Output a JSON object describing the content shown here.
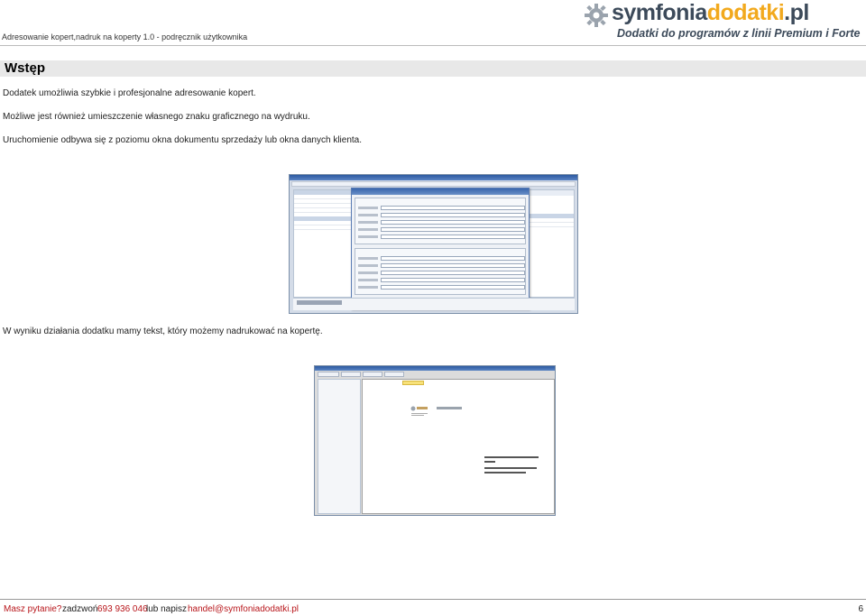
{
  "header": {
    "doc_title": "Adresowanie kopert,nadruk na koperty 1.0  - podręcznik użytkownika",
    "logo_brand": "symfonia",
    "logo_accent": "dodatki",
    "logo_tld": ".pl",
    "logo_tagline": "Dodatki do programów z linii Premium i Forte"
  },
  "section": {
    "title": "Wstęp"
  },
  "paragraphs": [
    "Dodatek umożliwia szybkie i profesjonalne adresowanie kopert.",
    "Możliwe jest również umieszczenie własnego znaku graficznego na wydruku.",
    "Uruchomienie odbywa się z poziomu okna dokumentu sprzedaży lub okna danych klienta.",
    "W wyniku działania dodatku mamy tekst, który możemy nadrukować na kopertę."
  ],
  "screenshot1": {
    "dialog_title": "Wybór adresu",
    "totals_label": "Do zapłaty:",
    "totals_value": "553,50",
    "totals_currency": "zł"
  },
  "footer": {
    "question": "Masz pytanie?",
    "call": "zadzwoń",
    "phone": "693 936 046",
    "or_write": "lub napisz",
    "email": "handel@symfoniadodatki.pl",
    "page_number": "6"
  },
  "colors": {
    "brand_dark": "#3c4a5a",
    "brand_accent": "#f2a91d",
    "footer_accent": "#b8161b",
    "section_bar": "#e8e8e8"
  }
}
